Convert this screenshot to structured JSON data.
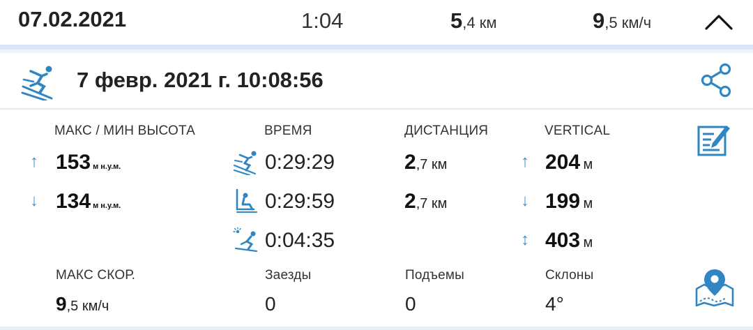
{
  "summary": {
    "date": "07.02.2021",
    "time": "1:04",
    "distance_value": "5",
    "distance_decimal": ",4 км",
    "speed_value": "9",
    "speed_decimal": ",5 км/ч"
  },
  "header": {
    "title": "7 февр. 2021 г. 10:08:56"
  },
  "labels": {
    "altitude": "МАКС / МИН ВЫСОТА",
    "time": "ВРЕМЯ",
    "distance": "ДИСТАНЦИЯ",
    "vertical": "VERTICAL",
    "max_speed": "МАКС СКОР.",
    "runs": "Заезды",
    "lifts": "Подъемы",
    "slopes": "Склоны"
  },
  "altitude": {
    "max_value": "153",
    "min_value": "134",
    "unit": "м н.у.м."
  },
  "times": {
    "skiing": "0:29:29",
    "lift": "0:29:59",
    "rest": "0:04:35"
  },
  "distances": {
    "d1_value": "2",
    "d1_decimal": ",7 км",
    "d2_value": "2",
    "d2_decimal": ",7 км"
  },
  "vertical": {
    "up_value": "204",
    "down_value": "199",
    "total_value": "403",
    "unit": "м"
  },
  "bottom": {
    "max_speed_value": "9",
    "max_speed_decimal": ",5 км/ч",
    "runs": "0",
    "lifts": "0",
    "slopes": "4°"
  },
  "icons": {
    "accent_color": "#2f86c2",
    "collapse": "chevron-up-icon",
    "skier": "skier-icon",
    "share": "share-icon",
    "edit": "edit-icon",
    "lift": "chairlift-icon",
    "rest": "rest-icon",
    "map": "map-pin-icon"
  },
  "chart_data": {
    "type": "table",
    "title": "7 февр. 2021 г. 10:08:56",
    "columns": [
      "МАКС / МИН ВЫСОТА",
      "ВРЕМЯ",
      "ДИСТАНЦИЯ",
      "VERTICAL"
    ],
    "rows": [
      [
        "153 м н.у.м.",
        "0:29:29",
        "2,7 км",
        "204 м"
      ],
      [
        "134 м н.у.м.",
        "0:29:59",
        "2,7 км",
        "199 м"
      ],
      [
        "",
        "0:04:35",
        "",
        "403 м"
      ]
    ],
    "extra": {
      "МАКС СКОР.": "9,5 км/ч",
      "Заезды": "0",
      "Подъемы": "0",
      "Склоны": "4°"
    }
  }
}
